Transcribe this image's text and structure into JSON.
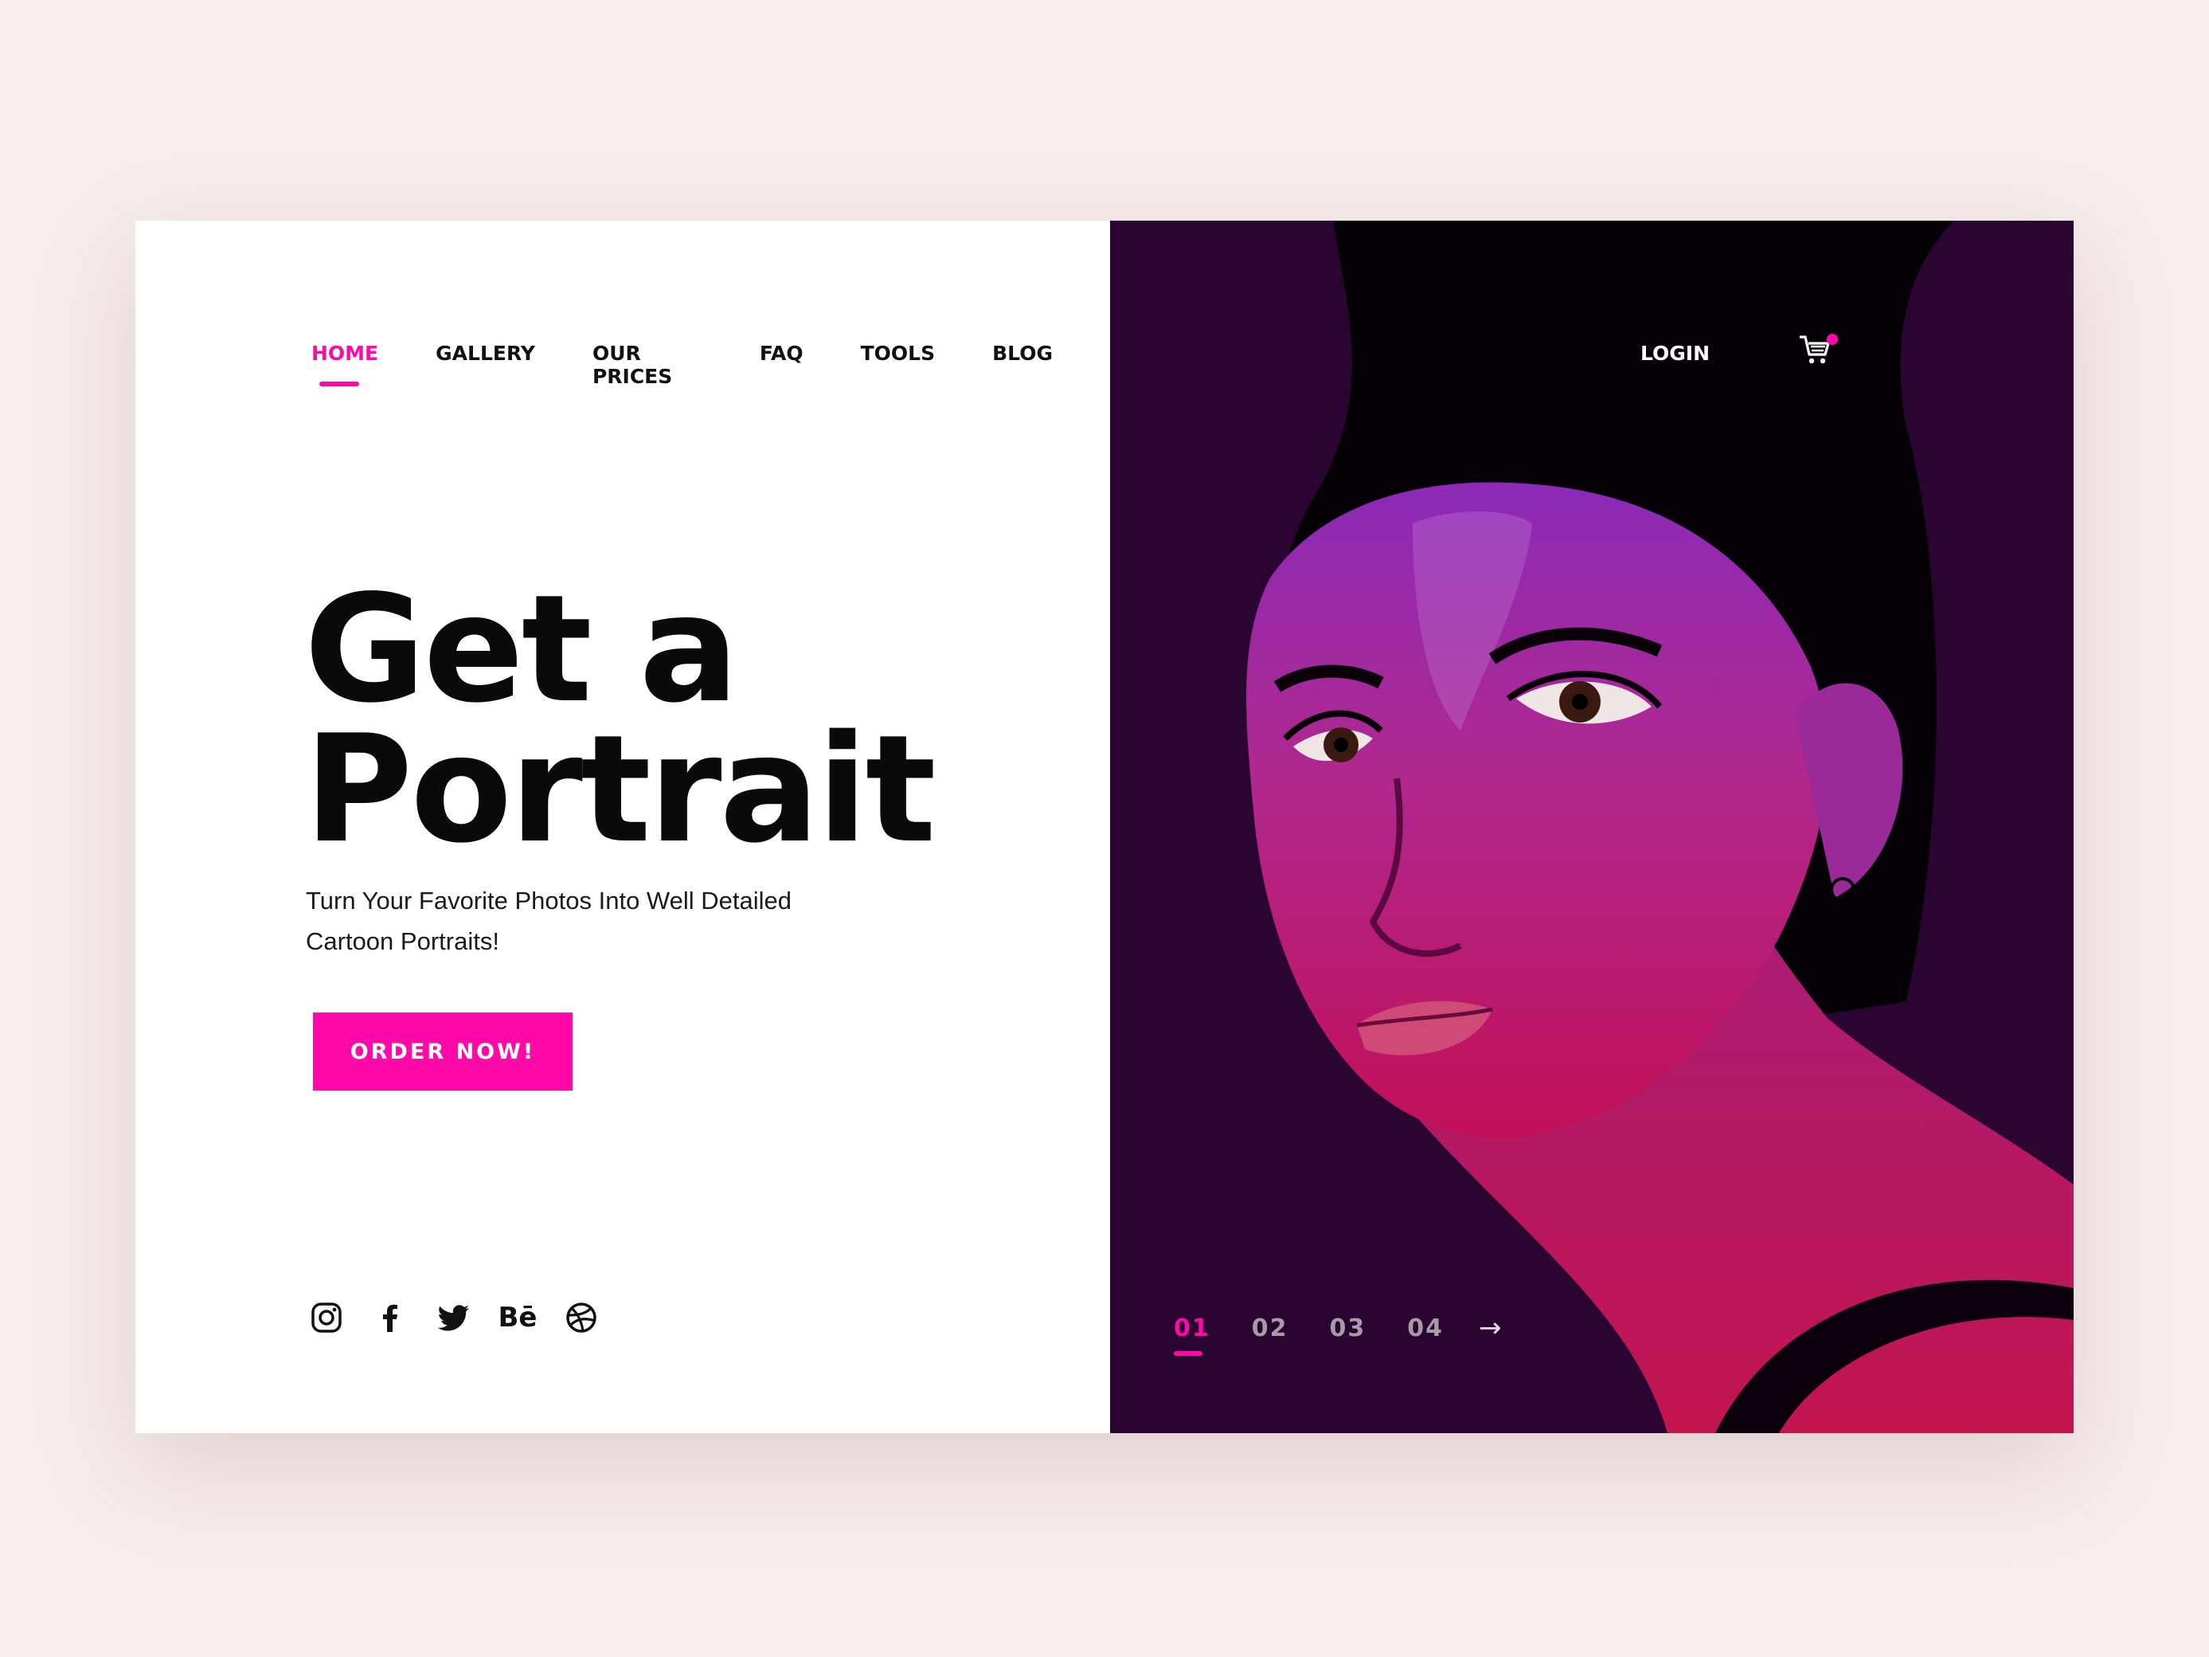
{
  "nav": {
    "items": [
      {
        "label": "HOME",
        "active": true
      },
      {
        "label": "GALLERY"
      },
      {
        "label": "OUR PRICES"
      },
      {
        "label": "FAQ"
      },
      {
        "label": "TOOLS"
      },
      {
        "label": "BLOG"
      }
    ],
    "login_label": "LOGIN",
    "cart_icon": "cart-icon"
  },
  "hero": {
    "title_line1": "Get a",
    "title_line2": "Portrait",
    "subtitle_line1": "Turn Your Favorite Photos Into Well Detailed",
    "subtitle_line2": "Cartoon Portraits!",
    "cta_label": "ORDER NOW!"
  },
  "social": {
    "icons": [
      "instagram-icon",
      "facebook-icon",
      "twitter-icon",
      "behance-icon",
      "dribbble-icon"
    ],
    "behance_text": "Bē"
  },
  "slider": {
    "pages": [
      "01",
      "02",
      "03",
      "04"
    ],
    "active_index": 0,
    "next_icon": "arrow-right-icon",
    "next_glyph": "→"
  },
  "colors": {
    "accent": "#ff0aa8",
    "page_background": "#f7eded",
    "right_panel": "#2a0532",
    "text_dark": "#0a0a0a"
  }
}
